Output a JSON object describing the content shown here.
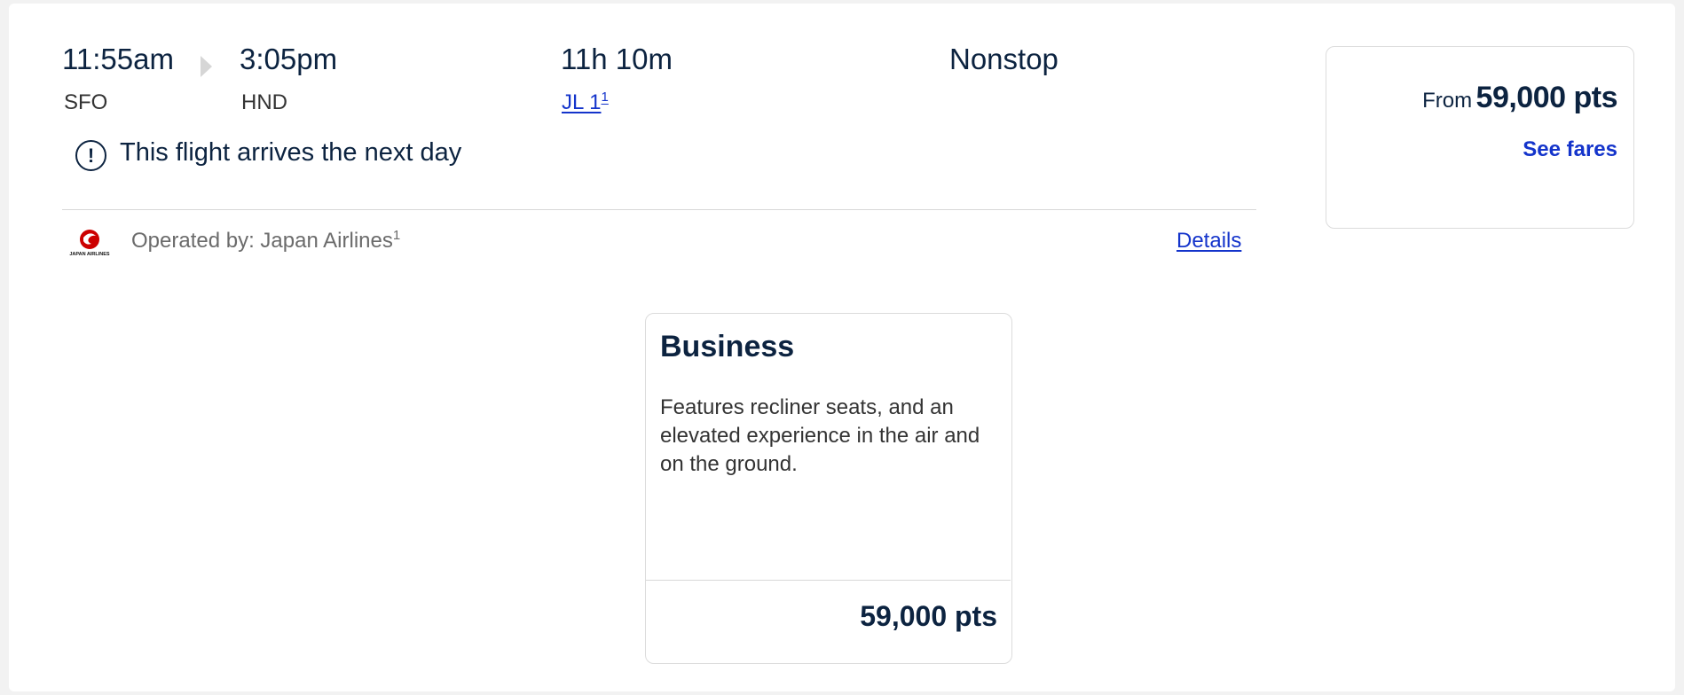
{
  "flight": {
    "depart_time": "11:55am",
    "depart_airport": "SFO",
    "arrive_time": "3:05pm",
    "arrive_airport": "HND",
    "duration": "11h 10m",
    "flight_number": "JL 1",
    "flight_number_sup": "1",
    "stops": "Nonstop",
    "notice": "This flight arrives the next day",
    "notice_icon": "!"
  },
  "operator": {
    "logo_text": "JAPAN AIRLINES",
    "label": "Operated by: Japan Airlines",
    "label_sup": "1",
    "details_link": "Details"
  },
  "price_summary": {
    "from_label": "From",
    "price": "59,000 pts",
    "see_fares": "See fares"
  },
  "fares": [
    {
      "cabin": "Business",
      "description": "Features recliner seats, and an elevated experience in the air and on the ground.",
      "price": "59,000 pts"
    }
  ],
  "colors": {
    "navy": "#0c2340",
    "link_blue": "#1434cb",
    "jal_red": "#cc0000"
  }
}
